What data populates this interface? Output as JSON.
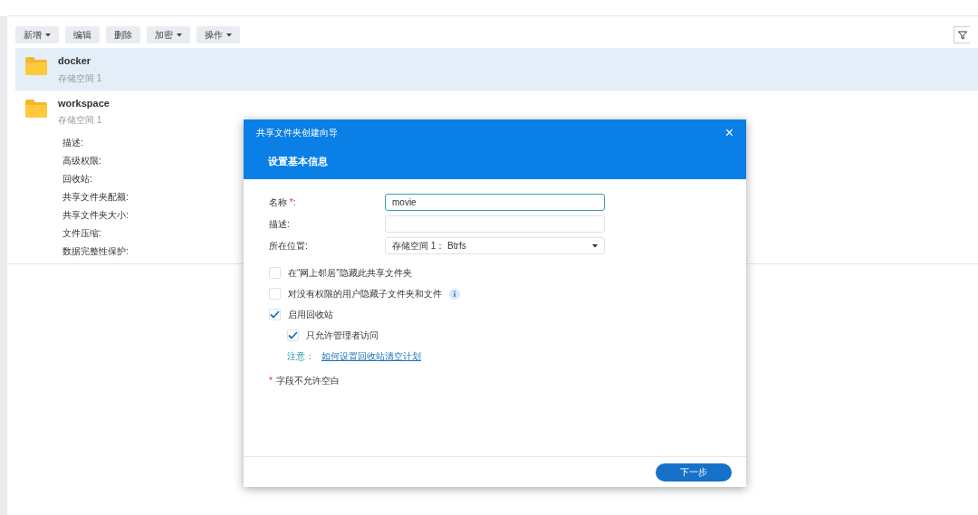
{
  "toolbar": {
    "buttons": [
      {
        "label": "新增",
        "dropdown": true
      },
      {
        "label": "编辑",
        "dropdown": false
      },
      {
        "label": "删除",
        "dropdown": false
      },
      {
        "label": "加密",
        "dropdown": true
      },
      {
        "label": "操作",
        "dropdown": true
      }
    ]
  },
  "folders": [
    {
      "name": "docker",
      "location": "存储空间 1",
      "selected": true
    },
    {
      "name": "workspace",
      "location": "存储空间 1",
      "selected": false,
      "details": [
        "描述:",
        "高级权限:",
        "回收站:",
        "共享文件夹配额:",
        "共享文件夹大小:",
        "文件压缩:",
        "数据完整性保护:"
      ]
    }
  ],
  "dialog": {
    "title": "共享文件夹创建向导",
    "close": "×",
    "heading": "设置基本信息",
    "fields": [
      {
        "kind": "text",
        "label": "名称 ",
        "required_mark": "*",
        "label_end": ":",
        "value": "movie"
      },
      {
        "kind": "text",
        "label": "描述:"
      },
      {
        "kind": "select",
        "label": "所在位置:",
        "value": "存储空间 1： Btrfs"
      }
    ],
    "options": [
      {
        "label": "在“网上邻居”隐藏此共享文件夹",
        "checked": false
      },
      {
        "label": "对没有权限的用户隐藏子文件夹和文件",
        "checked": false,
        "info": true
      },
      {
        "label": "启用回收站",
        "checked": true,
        "children": [
          {
            "label": "只允许管理者访问",
            "checked": true
          }
        ]
      }
    ],
    "note": {
      "label": "注意：",
      "link": "如何设置回收站清空计划"
    },
    "footnote": {
      "mark": "*",
      "text": "字段不允许空白"
    },
    "next_button": "下一步"
  }
}
